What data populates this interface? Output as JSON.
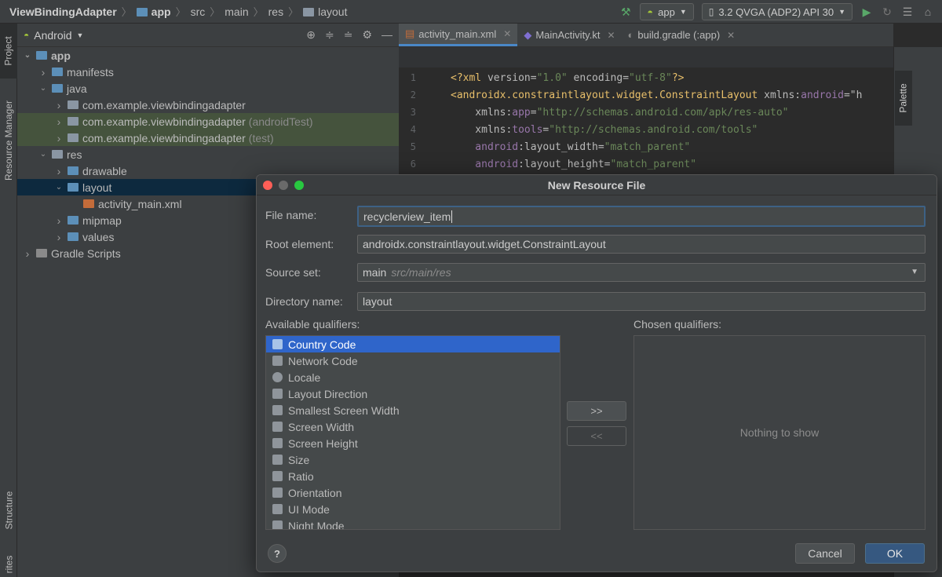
{
  "breadcrumb": [
    "ViewBindingAdapter",
    "app",
    "src",
    "main",
    "res",
    "layout"
  ],
  "toolbar": {
    "run_config": "app",
    "device": "3.2  QVGA (ADP2) API 30"
  },
  "left_strip": {
    "project": "Project",
    "resource_manager": "Resource Manager",
    "structure": "Structure",
    "favorites": "rites"
  },
  "project_panel": {
    "view_mode": "Android",
    "tree": [
      {
        "label": "app",
        "level": 0,
        "expanded": true,
        "icon": "folder-module-icon",
        "bold": true
      },
      {
        "label": "manifests",
        "level": 1,
        "expanded": false,
        "icon": "folder-icon"
      },
      {
        "label": "java",
        "level": 1,
        "expanded": true,
        "icon": "folder-icon"
      },
      {
        "label": "com.example.viewbindingadapter",
        "suffix": "",
        "level": 2,
        "expanded": false,
        "icon": "package-icon"
      },
      {
        "label": "com.example.viewbindingadapter",
        "suffix": "(androidTest)",
        "level": 2,
        "expanded": false,
        "icon": "package-icon",
        "highlight": true
      },
      {
        "label": "com.example.viewbindingadapter",
        "suffix": "(test)",
        "level": 2,
        "expanded": false,
        "icon": "package-icon",
        "highlight": true
      },
      {
        "label": "res",
        "level": 1,
        "expanded": true,
        "icon": "res-folder-icon"
      },
      {
        "label": "drawable",
        "level": 2,
        "expanded": false,
        "icon": "folder-icon"
      },
      {
        "label": "layout",
        "level": 2,
        "expanded": true,
        "icon": "folder-icon",
        "selected": true
      },
      {
        "label": "activity_main.xml",
        "level": 3,
        "icon": "layout-file-icon"
      },
      {
        "label": "mipmap",
        "level": 2,
        "expanded": false,
        "icon": "folder-icon"
      },
      {
        "label": "values",
        "level": 2,
        "expanded": false,
        "icon": "folder-icon"
      },
      {
        "label": "Gradle Scripts",
        "level": 0,
        "expanded": false,
        "icon": "gradle-icon"
      }
    ]
  },
  "editor": {
    "tabs": [
      {
        "label": "activity_main.xml",
        "active": true
      },
      {
        "label": "MainActivity.kt",
        "active": false
      },
      {
        "label": "build.gradle (:app)",
        "active": false
      }
    ],
    "lines": [
      {
        "n": "1",
        "parts": [
          [
            "pi",
            "<?xml "
          ],
          [
            "attr",
            "version"
          ],
          [
            "attr",
            "="
          ],
          [
            "str",
            "\"1.0\""
          ],
          [
            "attr",
            " encoding"
          ],
          [
            "attr",
            "="
          ],
          [
            "str",
            "\"utf-8\""
          ],
          [
            "pi",
            "?>"
          ]
        ]
      },
      {
        "n": "2",
        "parts": [
          [
            "tag",
            "<androidx.constraintlayout.widget.ConstraintLayout "
          ],
          [
            "attr",
            "xmlns:"
          ],
          [
            "ns",
            "android"
          ],
          [
            "attr",
            "=\"h"
          ]
        ]
      },
      {
        "n": "3",
        "parts": [
          [
            "attr",
            "    xmlns:"
          ],
          [
            "ns",
            "app"
          ],
          [
            "attr",
            "="
          ],
          [
            "str",
            "\"http://schemas.android.com/apk/res-auto\""
          ]
        ]
      },
      {
        "n": "4",
        "parts": [
          [
            "attr",
            "    xmlns:"
          ],
          [
            "ns",
            "tools"
          ],
          [
            "attr",
            "="
          ],
          [
            "str",
            "\"http://schemas.android.com/tools\""
          ]
        ]
      },
      {
        "n": "5",
        "parts": [
          [
            "ns",
            "    android"
          ],
          [
            "attr",
            ":layout_width="
          ],
          [
            "str",
            "\"match_parent\""
          ]
        ]
      },
      {
        "n": "6",
        "parts": [
          [
            "ns",
            "    android"
          ],
          [
            "attr",
            ":layout_height="
          ],
          [
            "str",
            "\"match_parent\""
          ]
        ]
      }
    ],
    "palette_label": "Palette"
  },
  "dialog": {
    "title": "New Resource File",
    "file_name_label": "File name:",
    "file_name_value": "recyclerview_item",
    "root_element_label": "Root element:",
    "root_element_value": "androidx.constraintlayout.widget.ConstraintLayout",
    "source_set_label": "Source set:",
    "source_set_value": "main",
    "source_set_hint": "src/main/res",
    "directory_label": "Directory name:",
    "directory_value": "layout",
    "available_label": "Available qualifiers:",
    "chosen_label": "Chosen qualifiers:",
    "qualifiers": [
      {
        "label": "Country Code",
        "icon": "country-code-icon",
        "selected": true
      },
      {
        "label": "Network Code",
        "icon": "network-code-icon"
      },
      {
        "label": "Locale",
        "icon": "globe-icon"
      },
      {
        "label": "Layout Direction",
        "icon": "layout-direction-icon"
      },
      {
        "label": "Smallest Screen Width",
        "icon": "smallest-width-icon"
      },
      {
        "label": "Screen Width",
        "icon": "screen-width-icon"
      },
      {
        "label": "Screen Height",
        "icon": "screen-height-icon"
      },
      {
        "label": "Size",
        "icon": "size-icon"
      },
      {
        "label": "Ratio",
        "icon": "ratio-icon"
      },
      {
        "label": "Orientation",
        "icon": "orientation-icon"
      },
      {
        "label": "UI Mode",
        "icon": "ui-mode-icon"
      },
      {
        "label": "Night Mode",
        "icon": "night-mode-icon"
      }
    ],
    "chosen_empty": "Nothing to show",
    "add_button": ">>",
    "remove_button": "<<",
    "help_button": "?",
    "cancel_button": "Cancel",
    "ok_button": "OK"
  },
  "colors": {
    "accent": "#2f65ca",
    "ok_button": "#365880",
    "selection": "#0d293e",
    "test_highlight": "#45533d"
  }
}
